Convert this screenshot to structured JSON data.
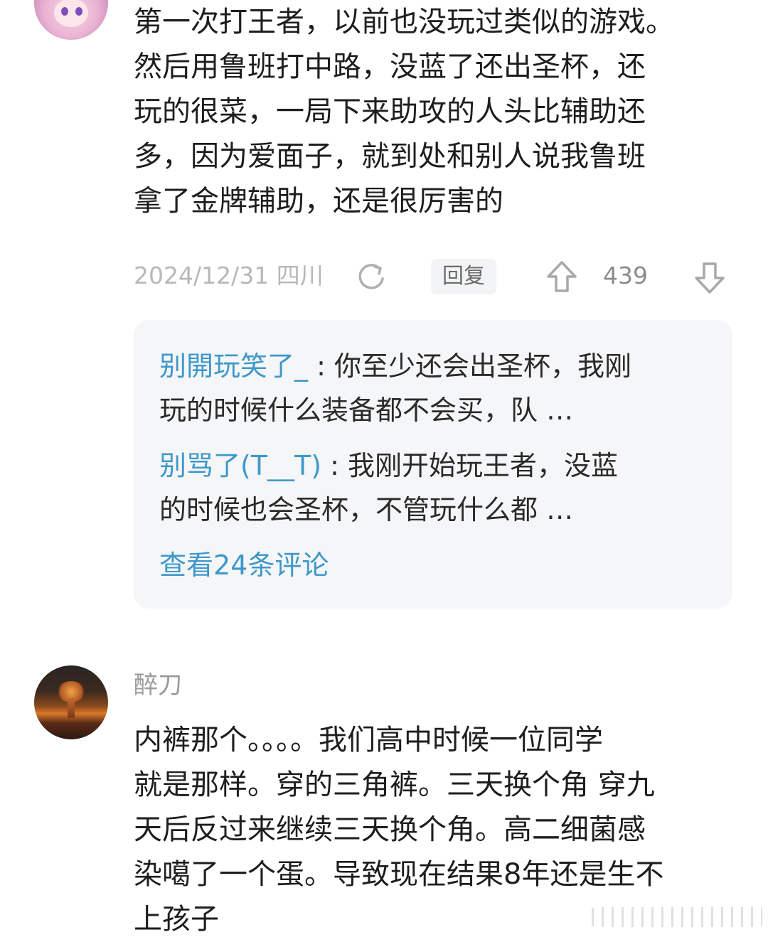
{
  "comment1": {
    "text_lines": [
      "第一次打王者，以前也没玩过类似的游戏。",
      "然后用鲁班打中路，没蓝了还出圣杯，还",
      "玩的很菜，一局下来助攻的人头比辅助还",
      "多，因为爱面子，就到处和别人说我鲁班",
      "拿了金牌辅助，还是很厉害的"
    ],
    "date_location": "2024/12/31 四川",
    "reply_label": "回复",
    "like_count": "439",
    "replies": [
      {
        "name": "别開玩笑了_",
        "separator": " : ",
        "line1": "你至少还会出圣杯，我刚",
        "line2": "玩的时候什么装备都不会买，队 …"
      },
      {
        "name": "别骂了(T__T)",
        "separator": " : ",
        "line1": "我刚开始玩王者，没蓝",
        "line2": "的时候也会圣杯，不管玩什么都 …"
      }
    ],
    "view_more": "查看24条评论"
  },
  "comment2": {
    "username": "醉刀",
    "text_lines": [
      "内裤那个。。。。我们高中时候一位同学",
      "就是那样。穿的三角裤。三天换个角 穿九",
      "天后反过来继续三天换个角。高二细菌感",
      "染噶了一个蛋。导致现在结果8年还是生不",
      "上孩子"
    ]
  },
  "icons": {
    "share": "refresh-share-icon",
    "upvote": "thumb-up-arrow-icon",
    "downvote": "thumb-down-arrow-icon"
  },
  "colors": {
    "link_blue": "#3f98c9",
    "meta_gray": "#b8b8b8",
    "reply_bg": "#f5f6f8"
  }
}
